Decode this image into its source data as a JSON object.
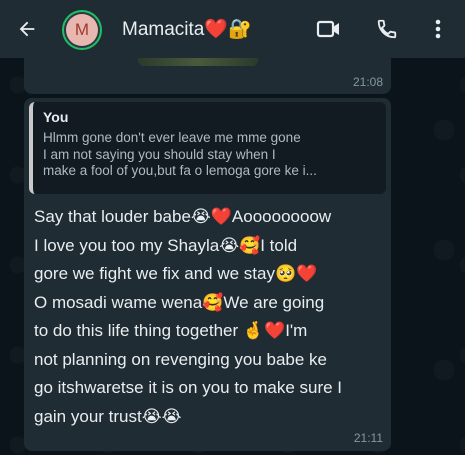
{
  "header": {
    "contact_name": "Mamacita❤️🔐",
    "avatar_initial": "M",
    "icons": [
      "back-arrow-icon",
      "video-call-icon",
      "voice-call-icon",
      "more-options-icon"
    ],
    "colors": {
      "header_bg": "#1f2c34",
      "avatar_ring": "#21c063",
      "avatar_bg": "#e8b7b0",
      "avatar_letter": "#a03a2e"
    }
  },
  "previous_message": {
    "time": "21:08"
  },
  "message": {
    "quoted": {
      "author": "You",
      "lines": [
        "Hlmm gone don't ever leave me mme gone",
        "I am not saying you should stay when I",
        "make a fool of you,but fa o lemoga gore ke i..."
      ]
    },
    "lines": [
      "Say that louder babe😭❤️Aoooooooow",
      "I love you too my Shayla😭🥰I told",
      "gore we fight we fix and we stay🥺❤️",
      "O mosadi wame wena🥰We are going",
      "to do this life thing together 🤞❤️I'm",
      "not planning on revenging you babe ke",
      "go itshwaretse it is on you to make sure I",
      "gain your trust😭😭"
    ],
    "time": "21:11"
  }
}
